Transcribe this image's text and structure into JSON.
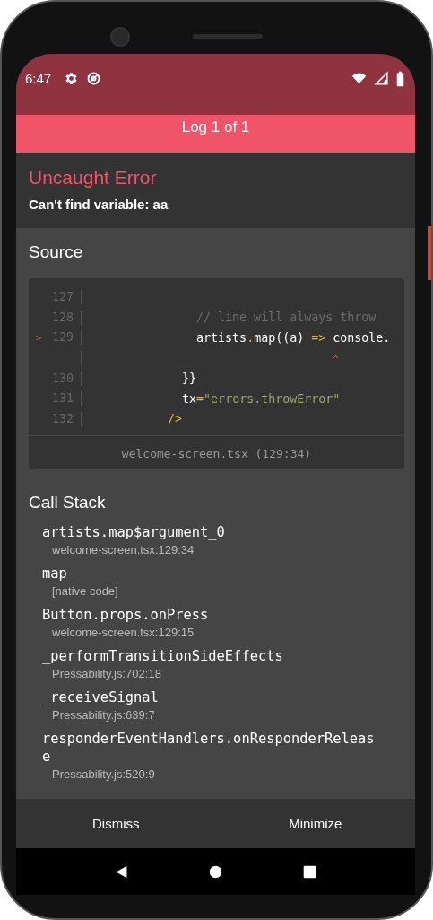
{
  "status_bar": {
    "time": "6:47"
  },
  "header": {
    "title": "Log 1 of 1"
  },
  "error": {
    "title": "Uncaught Error",
    "message": "Can't find variable: aa"
  },
  "source": {
    "heading": "Source",
    "lines": [
      {
        "number": "127"
      },
      {
        "number": "128",
        "segments": [
          {
            "kind": "comment",
            "text": "              // line will always throw"
          }
        ]
      },
      {
        "number": "129",
        "marker": ">",
        "segments": [
          {
            "kind": "plain",
            "text": "              artists"
          },
          {
            "kind": "punct",
            "text": "."
          },
          {
            "kind": "plain",
            "text": "map((a) "
          },
          {
            "kind": "punct",
            "text": "=>"
          },
          {
            "kind": "plain",
            "text": " console."
          }
        ]
      },
      {
        "segments": [
          {
            "kind": "caret",
            "text": "                                 ^"
          }
        ]
      },
      {
        "number": "130",
        "segments": [
          {
            "kind": "plain",
            "text": "            }}"
          }
        ]
      },
      {
        "number": "131",
        "segments": [
          {
            "kind": "plain",
            "text": "            tx"
          },
          {
            "kind": "punct",
            "text": "="
          },
          {
            "kind": "string",
            "text": "\"errors.throwError\""
          }
        ]
      },
      {
        "number": "132",
        "segments": [
          {
            "kind": "punct",
            "text": "          />"
          }
        ]
      }
    ],
    "file": "welcome-screen.tsx (129:34)"
  },
  "call_stack": {
    "heading": "Call Stack",
    "frames": [
      {
        "name": "artists.map$argument_0",
        "location": "welcome-screen.tsx:129:34"
      },
      {
        "name": "map",
        "location": "[native code]"
      },
      {
        "name": "Button.props.onPress",
        "location": "welcome-screen.tsx:129:15"
      },
      {
        "name": "_performTransitionSideEffects",
        "location": "Pressability.js:702:18"
      },
      {
        "name": "_receiveSignal",
        "location": "Pressability.js:639:7"
      },
      {
        "name": "responderEventHandlers.onResponderRelease",
        "location": "Pressability.js:520:9"
      }
    ]
  },
  "buttons": [
    "Dismiss",
    "Minimize"
  ]
}
